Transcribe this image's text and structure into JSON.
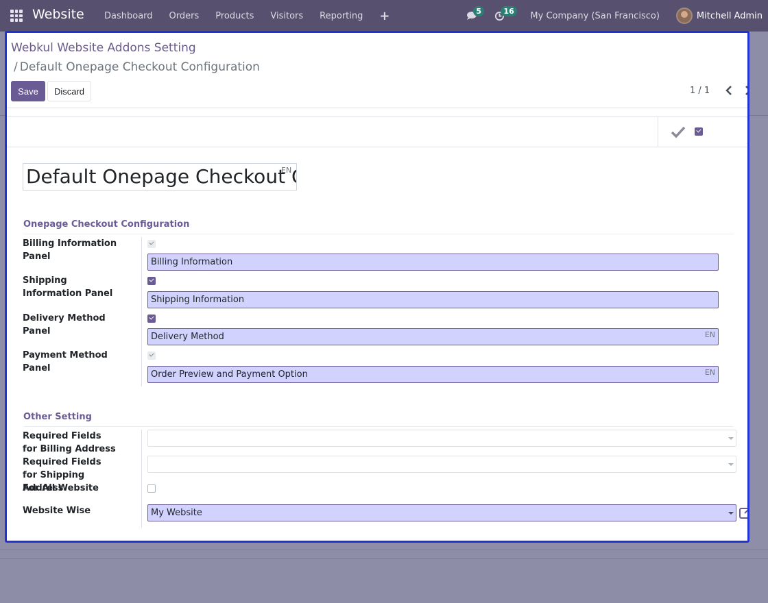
{
  "navbar": {
    "brand": "Website",
    "menu": [
      "Dashboard",
      "Orders",
      "Products",
      "Visitors",
      "Reporting"
    ],
    "messages_count": "5",
    "activities_count": "16",
    "company": "My Company (San Francisco)",
    "user": "Mitchell Admin"
  },
  "breadcrumb": {
    "root": "Webkul Website Addons Setting",
    "separator": "/",
    "current": "Default Onepage Checkout Configuration"
  },
  "buttons": {
    "save": "Save",
    "discard": "Discard"
  },
  "pager": {
    "value": "1 / 1"
  },
  "record": {
    "name": "Default Onepage Checkout C",
    "lang_badge": "EN"
  },
  "sections": {
    "onepage": {
      "title": "Onepage Checkout Configuration",
      "rows": [
        {
          "label": "Billing Information Panel",
          "checked": true,
          "readonly": true,
          "value": "Billing Information",
          "lang": ""
        },
        {
          "label": "Shipping Information Panel",
          "checked": true,
          "readonly": false,
          "value": "Shipping Information",
          "lang": ""
        },
        {
          "label": "Delivery Method Panel",
          "checked": true,
          "readonly": false,
          "value": "Delivery Method",
          "lang": "EN"
        },
        {
          "label": "Payment Method Panel",
          "checked": true,
          "readonly": true,
          "value": "Order Preview and Payment Option",
          "lang": "EN"
        }
      ]
    },
    "other": {
      "title": "Other Setting",
      "billing_required_label": "Required Fields for Billing Address",
      "shipping_required_label": "Required Fields for Shipping Address",
      "all_website_label": "For All Website",
      "all_website_checked": false,
      "website_wise_label": "Website Wise",
      "website_wise_value": "My Website"
    }
  },
  "colors": {
    "primary": "#6b5b95",
    "navbar": "#57506f",
    "highlight_input": "#d2d2ff",
    "modal_border": "#2233d6"
  },
  "icons": [
    "apps-grid-icon",
    "chat-icon",
    "clock-icon",
    "plus-icon",
    "chevron-left-icon",
    "chevron-right-icon",
    "check-icon",
    "external-link-icon"
  ]
}
